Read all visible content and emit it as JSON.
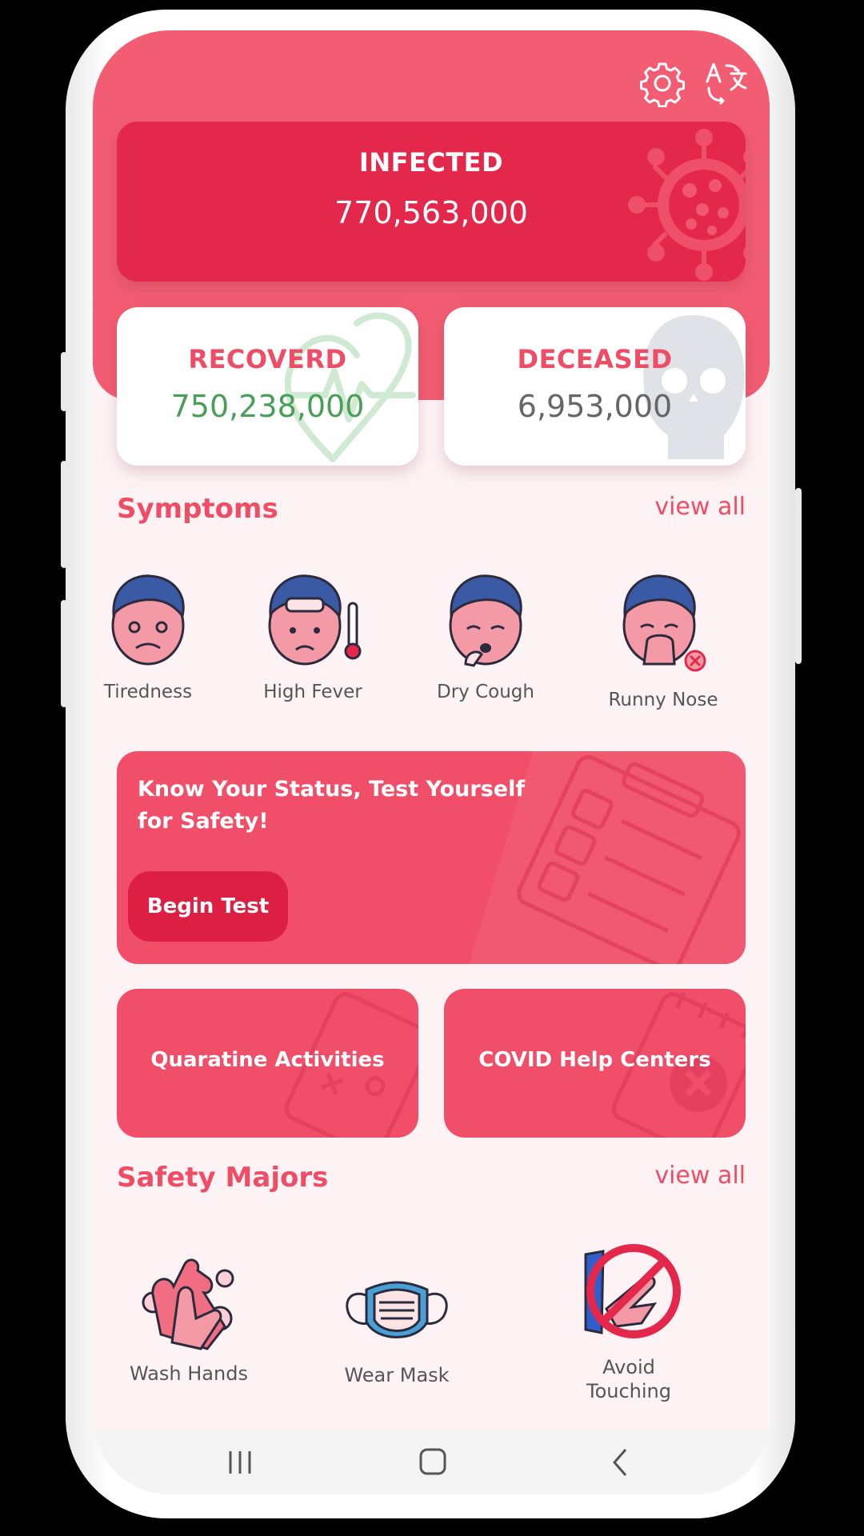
{
  "stats": {
    "infected": {
      "label": "INFECTED",
      "value": "770,563,000"
    },
    "recovered": {
      "label": "RECOVERD",
      "value": "750,238,000"
    },
    "deceased": {
      "label": "DECEASED",
      "value": "6,953,000"
    }
  },
  "symptoms": {
    "title": "Symptoms",
    "view_all": "view all",
    "items": [
      {
        "label": "Tiredness",
        "icon": "tired-face-icon"
      },
      {
        "label": "High Fever",
        "icon": "fever-face-icon"
      },
      {
        "label": "Dry Cough",
        "icon": "cough-face-icon"
      },
      {
        "label": "Runny Nose",
        "icon": "runny-nose-face-icon"
      }
    ]
  },
  "banner": {
    "text": "Know Your Status, Test Yourself for Safety!",
    "button": "Begin Test"
  },
  "tiles": [
    {
      "label": "Quaratine Activities"
    },
    {
      "label": "COVID Help Centers"
    }
  ],
  "safety": {
    "title": "Safety Majors",
    "view_all": "view all",
    "items": [
      {
        "label": "Wash Hands",
        "icon": "wash-hands-icon"
      },
      {
        "label": "Wear Mask",
        "icon": "mask-icon"
      },
      {
        "label_line1": "Avoid",
        "label_line2": "Touching",
        "icon": "no-touching-icon"
      }
    ]
  },
  "colors": {
    "accent": "#f25d73",
    "infected": "#e3284b",
    "recovered_value": "#4a9e58",
    "deceased_value": "#666666"
  }
}
